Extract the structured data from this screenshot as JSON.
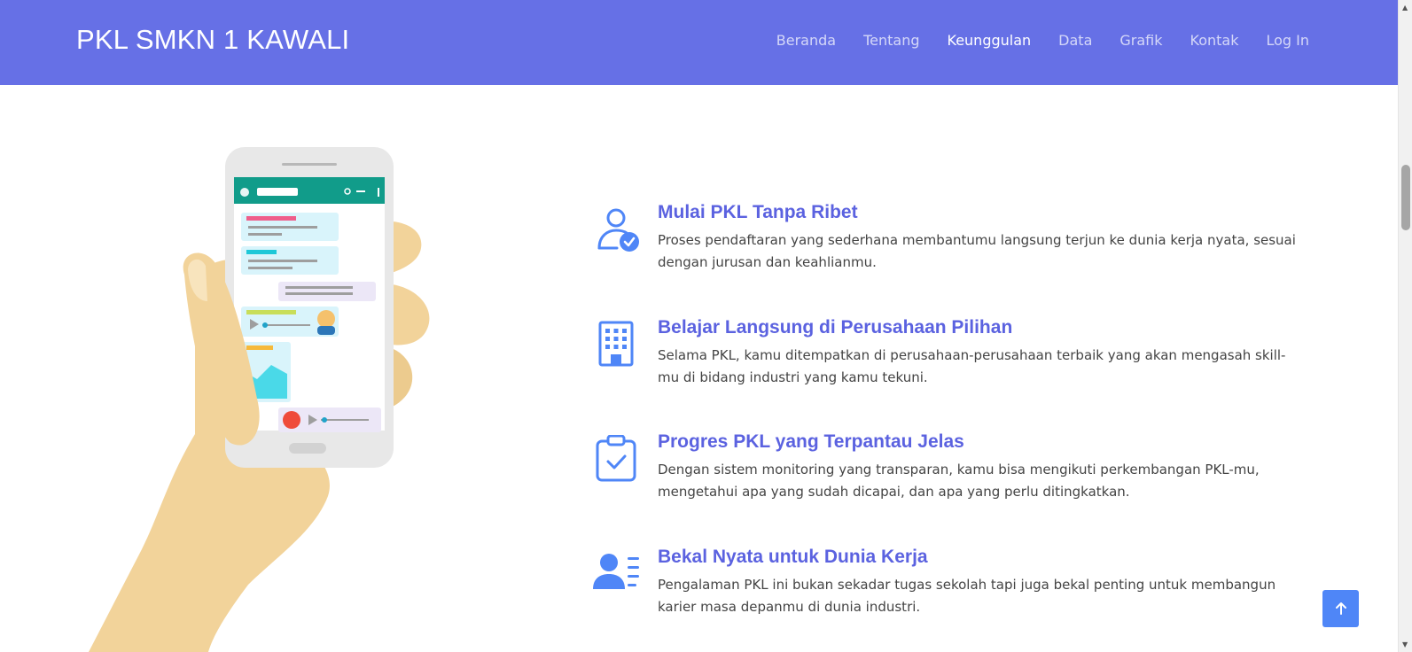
{
  "navbar": {
    "brand": "PKL SMKN 1 KAWALI",
    "links": [
      {
        "label": "Beranda",
        "active": false
      },
      {
        "label": "Tentang",
        "active": false
      },
      {
        "label": "Keunggulan",
        "active": true
      },
      {
        "label": "Data",
        "active": false
      },
      {
        "label": "Grafik",
        "active": false
      },
      {
        "label": "Kontak",
        "active": false
      },
      {
        "label": "Log In",
        "active": false
      }
    ]
  },
  "features": [
    {
      "icon": "user-check-icon",
      "title": "Mulai PKL Tanpa Ribet",
      "description": "Proses pendaftaran yang sederhana membantumu langsung terjun ke dunia kerja nyata, sesuai dengan jurusan dan keahlianmu."
    },
    {
      "icon": "building-icon",
      "title": "Belajar Langsung di Perusahaan Pilihan",
      "description": "Selama PKL, kamu ditempatkan di perusahaan-perusahaan terbaik yang akan mengasah skill-mu di bidang industri yang kamu tekuni."
    },
    {
      "icon": "clipboard-check-icon",
      "title": "Progres PKL yang Terpantau Jelas",
      "description": "Dengan sistem monitoring yang transparan, kamu bisa mengikuti perkembangan PKL-mu, mengetahui apa yang sudah dicapai, dan apa yang perlu ditingkatkan."
    },
    {
      "icon": "person-lines-icon",
      "title": "Bekal Nyata untuk Dunia Kerja",
      "description": "Pengalaman PKL ini bukan sekadar tugas sekolah tapi juga bekal penting untuk membangun karier masa depanmu di dunia industri."
    }
  ],
  "colors": {
    "navbar": "#6670e6",
    "accent": "#5b62e0",
    "icon": "#4f86f7",
    "back_to_top": "#4f86f7"
  }
}
